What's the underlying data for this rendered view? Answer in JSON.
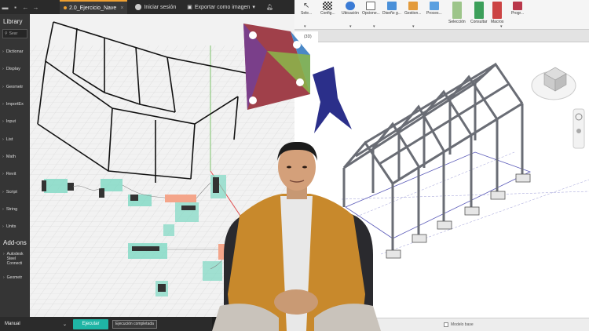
{
  "dynamo": {
    "tab_title": "2.0_Ejercicio_Nave",
    "sign_in": "Iniciar sesión",
    "export": "Exportar como imagen",
    "library": {
      "title": "Library",
      "search_placeholder": "Sear",
      "items": [
        "Dictionar",
        "Display",
        "Geometr",
        "ImportEx",
        "Input",
        "List",
        "Math",
        "Revit",
        "Script",
        "String",
        "Units"
      ],
      "addons_title": "Add-ons",
      "addon_items": [
        "Autodesk Steel Connecti"
      ],
      "more": "Geometr"
    },
    "run_mode": "Manual",
    "run_button": "Ejecutar",
    "run_status": "Ejecución completada"
  },
  "revit": {
    "ribbon": [
      "Sele...",
      "Config...",
      "Ubicación",
      "Opcione...",
      "Diseño g...",
      "Gestion...",
      "Proces...",
      "Selección",
      "Consultar",
      "Macros",
      "Progr..."
    ],
    "view_tab": "(3D)",
    "status_models": "Modelo base"
  },
  "colors": {
    "dynamo_accent": "#f0a030",
    "run_button": "#1fb5a5",
    "revit_logo": "#2b2f8a"
  }
}
